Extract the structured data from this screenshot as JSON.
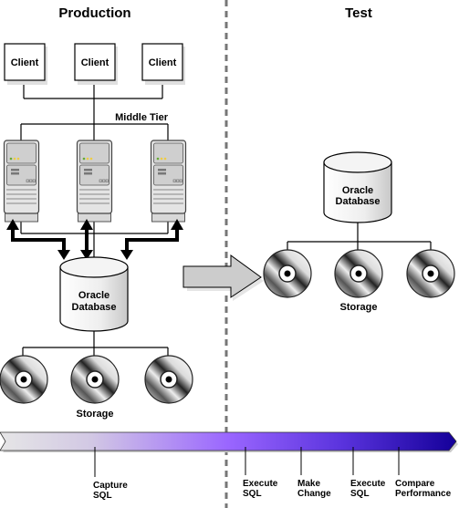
{
  "production": {
    "title": "Production",
    "clients": [
      "Client",
      "Client",
      "Client"
    ],
    "middle_tier_label": "Middle Tier",
    "database_label_line1": "Oracle",
    "database_label_line2": "Database",
    "storage_label": "Storage"
  },
  "test": {
    "title": "Test",
    "database_label_line1": "Oracle",
    "database_label_line2": "Database",
    "storage_label": "Storage"
  },
  "timeline": {
    "gradient_colors": [
      "#e8e8e8",
      "#9966ff",
      "#1a0099"
    ],
    "steps": [
      {
        "line1": "Capture",
        "line2": "SQL"
      },
      {
        "line1": "Execute",
        "line2": "SQL"
      },
      {
        "line1": "Make",
        "line2": "Change"
      },
      {
        "line1": "Execute",
        "line2": "SQL"
      },
      {
        "line1": "Compare",
        "line2": "Performance"
      }
    ]
  }
}
